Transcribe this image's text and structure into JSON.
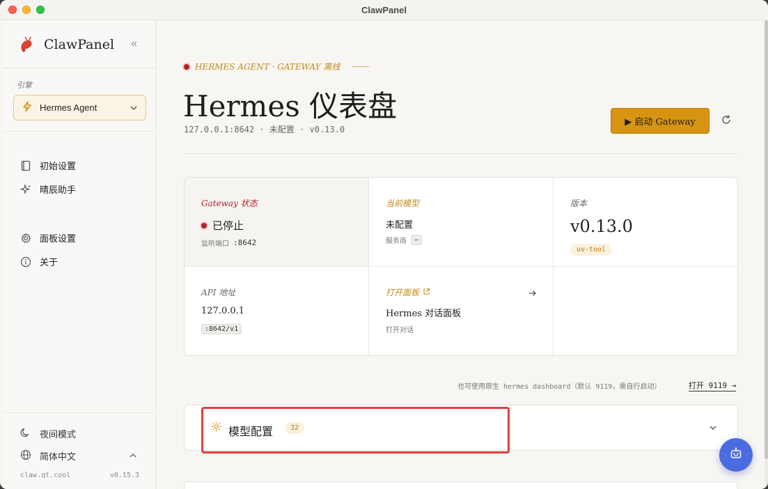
{
  "window": {
    "title": "ClawPanel"
  },
  "sidebar": {
    "brand": "ClawPanel",
    "collapse_icon": "«",
    "engine_label": "引擎",
    "engine_value": "Hermes Agent",
    "nav_top": [
      {
        "label": "初始设置",
        "icon": "book-icon"
      },
      {
        "label": "晴辰助手",
        "icon": "sparkle-icon"
      }
    ],
    "nav_mid": [
      {
        "label": "面板设置",
        "icon": "gear-icon"
      },
      {
        "label": "关于",
        "icon": "info-icon"
      }
    ],
    "night_mode": "夜间模式",
    "language": "简体中文",
    "footer_domain": "claw.qt.cool",
    "footer_version": "v0.15.3"
  },
  "main": {
    "eyebrow": "HERMES AGENT · GATEWAY 离线",
    "title": "Hermes 仪表盘",
    "subline": "127.0.0.1:8642 · 未配置 · v0.13.0",
    "start_button": "▶ 启动 Gateway",
    "cards": {
      "gateway": {
        "label": "Gateway 状态",
        "value": "已停止",
        "sub_label": "监听端口",
        "sub_value": ":8642"
      },
      "model": {
        "label": "当前模型",
        "value": "未配置",
        "sub_label": "服务商",
        "sub_value": "—"
      },
      "version": {
        "label": "版本",
        "value": "v0.13.0",
        "pill": "uv-tool"
      },
      "api": {
        "label": "API 地址",
        "value": "127.0.0.1",
        "sub_value": ":8642/v1"
      },
      "panel": {
        "label": "打开面板",
        "value": "Hermes 对话面板",
        "sub_label": "打开对话"
      }
    },
    "hint": "也可使用原生 hermes dashboard（默认 9119，需自行启动）",
    "hint_link": "打开 9119 →",
    "model_section": {
      "title": "模型配置",
      "count": "32"
    }
  },
  "colors": {
    "accent": "#d69412",
    "danger": "#b4202a",
    "fab": "#4b6be0"
  }
}
